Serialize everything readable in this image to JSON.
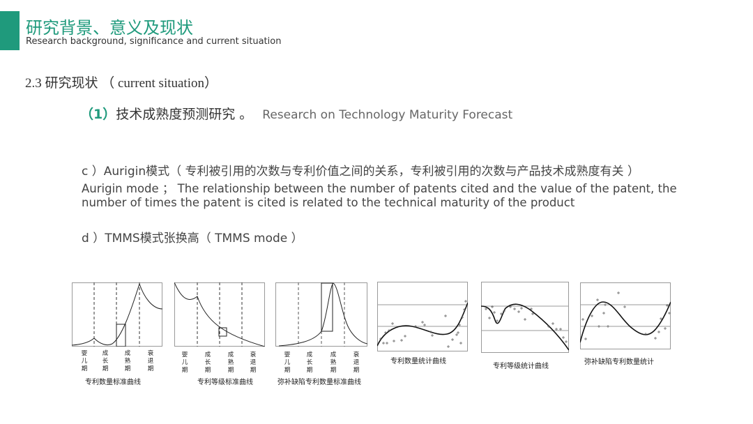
{
  "header": {
    "title": "研究背景、意义及现状",
    "subtitle": "Research background, significance and current situation"
  },
  "section": {
    "heading": "2.3 研究现状 （ current situation）"
  },
  "point1": {
    "number": "（1）",
    "label": "技术成熟度预测研究 。",
    "english": "Research on Technology Maturity Forecast"
  },
  "items": {
    "c_title": "c ）Aurigin模式（ 专利被引用的次数与专利价值之间的关系，专利被引用的次数与产品技术成熟度有关 ）",
    "c_line1": "Aurigin mode ； The relationship between the number of patents cited and the value of the patent, the",
    "c_line2": "number of times the patent is cited is related to the technical maturity of the product",
    "d_title": "d ）TMMS模式张换高（ TMMS mode ）"
  },
  "stages": [
    "婴儿期",
    "成长期",
    "成熟期",
    "衰退期"
  ],
  "figures": [
    {
      "caption": "专利数量标准曲线"
    },
    {
      "caption": "专利等级标准曲线"
    },
    {
      "caption": "弥补缺陷专利数量标准曲线"
    },
    {
      "caption": "专利数量统计曲线"
    },
    {
      "caption": "专利等级统计曲线"
    },
    {
      "caption": "弥补缺陷专利数量统计"
    }
  ]
}
